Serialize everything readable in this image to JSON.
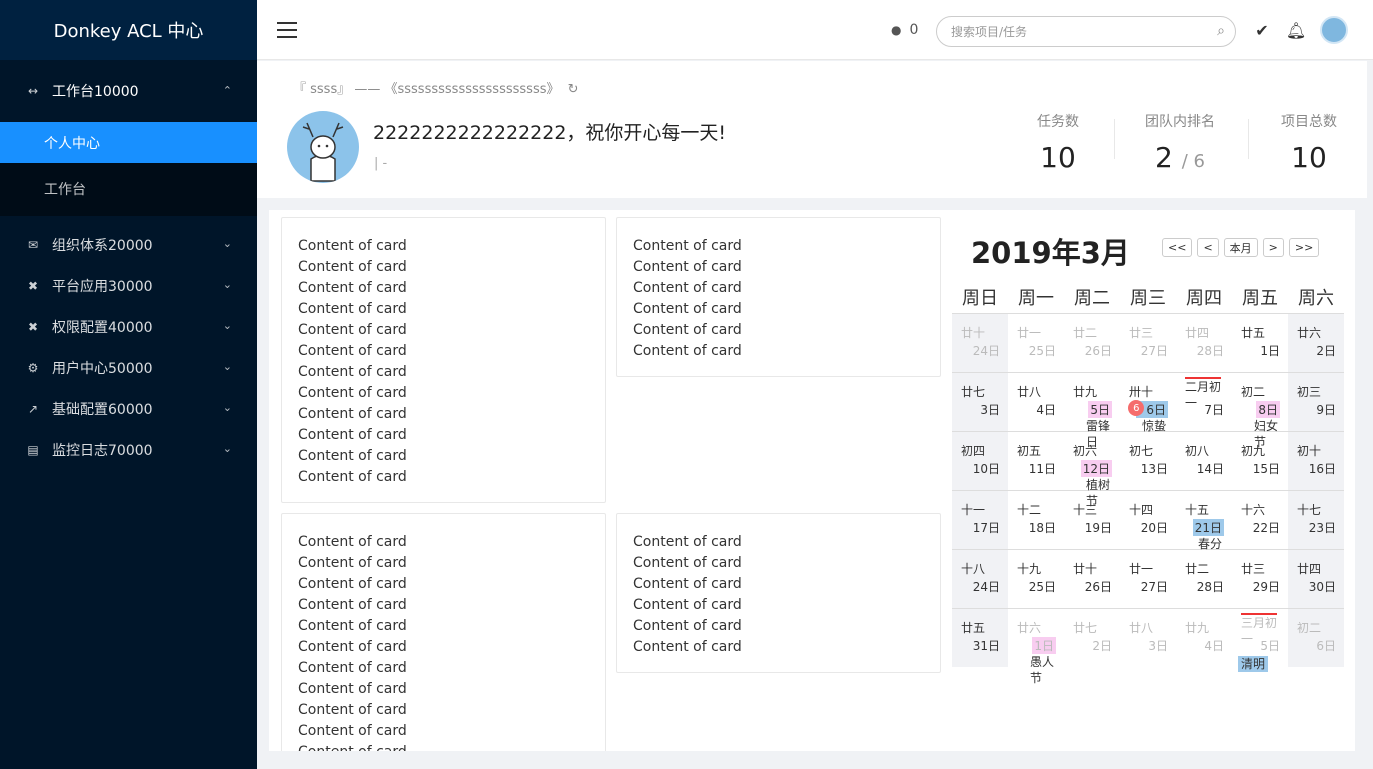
{
  "app": {
    "title": "Donkey ACL 中心"
  },
  "sidebar": {
    "open_group": {
      "label": "工作台10000",
      "icon": "swap-arrows-icon"
    },
    "sub_items": [
      {
        "label": "个人中心",
        "active": true
      },
      {
        "label": "工作台",
        "active": false
      }
    ],
    "groups": [
      {
        "label": "组织体系20000",
        "icon": "mail-icon"
      },
      {
        "label": "平台应用30000",
        "icon": "tools-icon"
      },
      {
        "label": "权限配置40000",
        "icon": "tools-icon"
      },
      {
        "label": "用户中心50000",
        "icon": "gear-icon"
      },
      {
        "label": "基础配置60000",
        "icon": "hammer-icon"
      },
      {
        "label": "监控日志70000",
        "icon": "document-icon"
      }
    ]
  },
  "header": {
    "online_count": "0",
    "search_placeholder": "搜索项目/任务"
  },
  "profile": {
    "breadcrumb": "『 ssss』 —— 《ssssssssssssssssssssss》",
    "greeting": "2222222222222222，祝你开心每一天!",
    "sub": "| -",
    "stats": [
      {
        "label": "任务数",
        "value": "10",
        "suffix": ""
      },
      {
        "label": "团队内排名",
        "value": "2",
        "suffix": "/ 6"
      },
      {
        "label": "项目总数",
        "value": "10",
        "suffix": ""
      }
    ]
  },
  "cards": {
    "line": "Content of card"
  },
  "calendar": {
    "title": "2019年3月",
    "buttons": [
      "<<",
      "<",
      "本月",
      ">",
      ">>"
    ],
    "weekdays": [
      "周日",
      "周一",
      "周二",
      "周三",
      "周四",
      "周五",
      "周六"
    ],
    "weeks": [
      [
        {
          "l": "廿十",
          "d": "24日"
        },
        {
          "l": "廿一",
          "d": "25日"
        },
        {
          "l": "廿二",
          "d": "26日"
        },
        {
          "l": "廿三",
          "d": "27日"
        },
        {
          "l": "廿四",
          "d": "28日"
        },
        {
          "l": "廿五",
          "d": "1日"
        },
        {
          "l": "廿六",
          "d": "2日"
        }
      ],
      [
        {
          "l": "廿七",
          "d": "3日"
        },
        {
          "l": "廿八",
          "d": "4日"
        },
        {
          "l": "廿九",
          "d": "5日",
          "f": "雷锋日"
        },
        {
          "l": "卅十",
          "d": "6日",
          "f": "惊蛰",
          "badge": "6"
        },
        {
          "l": "二月初一",
          "d": "7日"
        },
        {
          "l": "初二",
          "d": "8日",
          "f": "妇女节"
        },
        {
          "l": "初三",
          "d": "9日"
        }
      ],
      [
        {
          "l": "初四",
          "d": "10日"
        },
        {
          "l": "初五",
          "d": "11日"
        },
        {
          "l": "初六",
          "d": "12日",
          "f": "植树节"
        },
        {
          "l": "初七",
          "d": "13日"
        },
        {
          "l": "初八",
          "d": "14日"
        },
        {
          "l": "初九",
          "d": "15日"
        },
        {
          "l": "初十",
          "d": "16日"
        }
      ],
      [
        {
          "l": "十一",
          "d": "17日"
        },
        {
          "l": "十二",
          "d": "18日"
        },
        {
          "l": "十三",
          "d": "19日"
        },
        {
          "l": "十四",
          "d": "20日"
        },
        {
          "l": "十五",
          "d": "21日",
          "f": "春分"
        },
        {
          "l": "十六",
          "d": "22日"
        },
        {
          "l": "十七",
          "d": "23日"
        }
      ],
      [
        {
          "l": "十八",
          "d": "24日"
        },
        {
          "l": "十九",
          "d": "25日"
        },
        {
          "l": "廿十",
          "d": "26日"
        },
        {
          "l": "廿一",
          "d": "27日"
        },
        {
          "l": "廿二",
          "d": "28日"
        },
        {
          "l": "廿三",
          "d": "29日"
        },
        {
          "l": "廿四",
          "d": "30日"
        }
      ],
      [
        {
          "l": "廿五",
          "d": "31日"
        },
        {
          "l": "廿六",
          "d": "1日",
          "f": "愚人节"
        },
        {
          "l": "廿七",
          "d": "2日"
        },
        {
          "l": "廿八",
          "d": "3日"
        },
        {
          "l": "廿九",
          "d": "4日"
        },
        {
          "l": "三月初一",
          "d": "5日",
          "f": "清明"
        },
        {
          "l": "初二",
          "d": "6日"
        }
      ]
    ]
  },
  "colors": {
    "sidebar": "#001529",
    "accent": "#1890ff",
    "badge": "#f56c6c"
  }
}
